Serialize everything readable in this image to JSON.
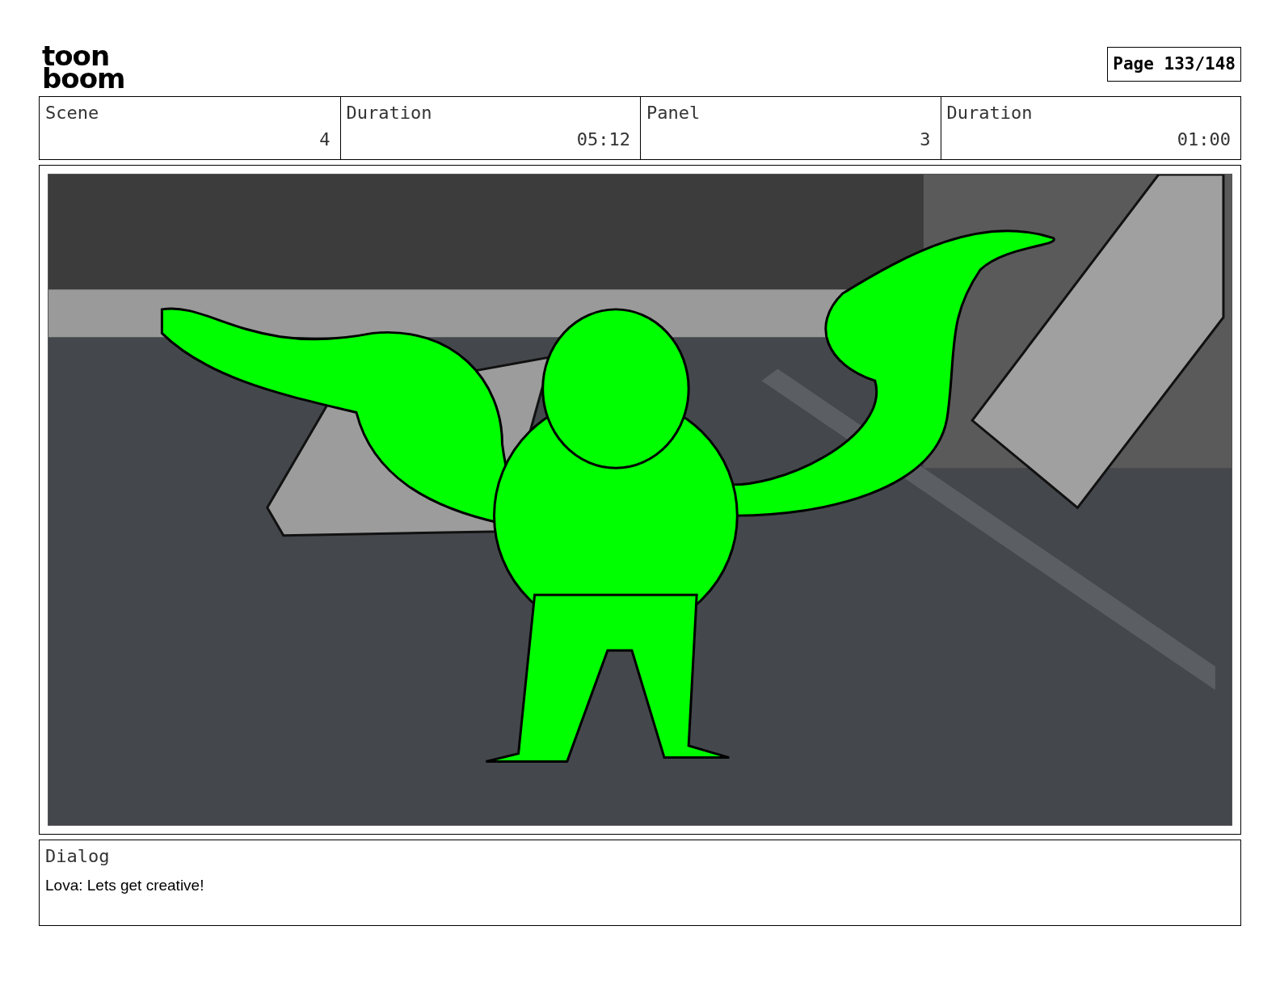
{
  "logo": {
    "lines": [
      "toon",
      "boom"
    ]
  },
  "page": "Page 133/148",
  "info": [
    {
      "label": "Scene",
      "value": "4"
    },
    {
      "label": "Duration",
      "value": "05:12"
    },
    {
      "label": "Panel",
      "value": "3"
    },
    {
      "label": "Duration",
      "value": "01:00"
    }
  ],
  "dialog": {
    "label": "Dialog",
    "text": "Lova: Lets get creative!"
  }
}
